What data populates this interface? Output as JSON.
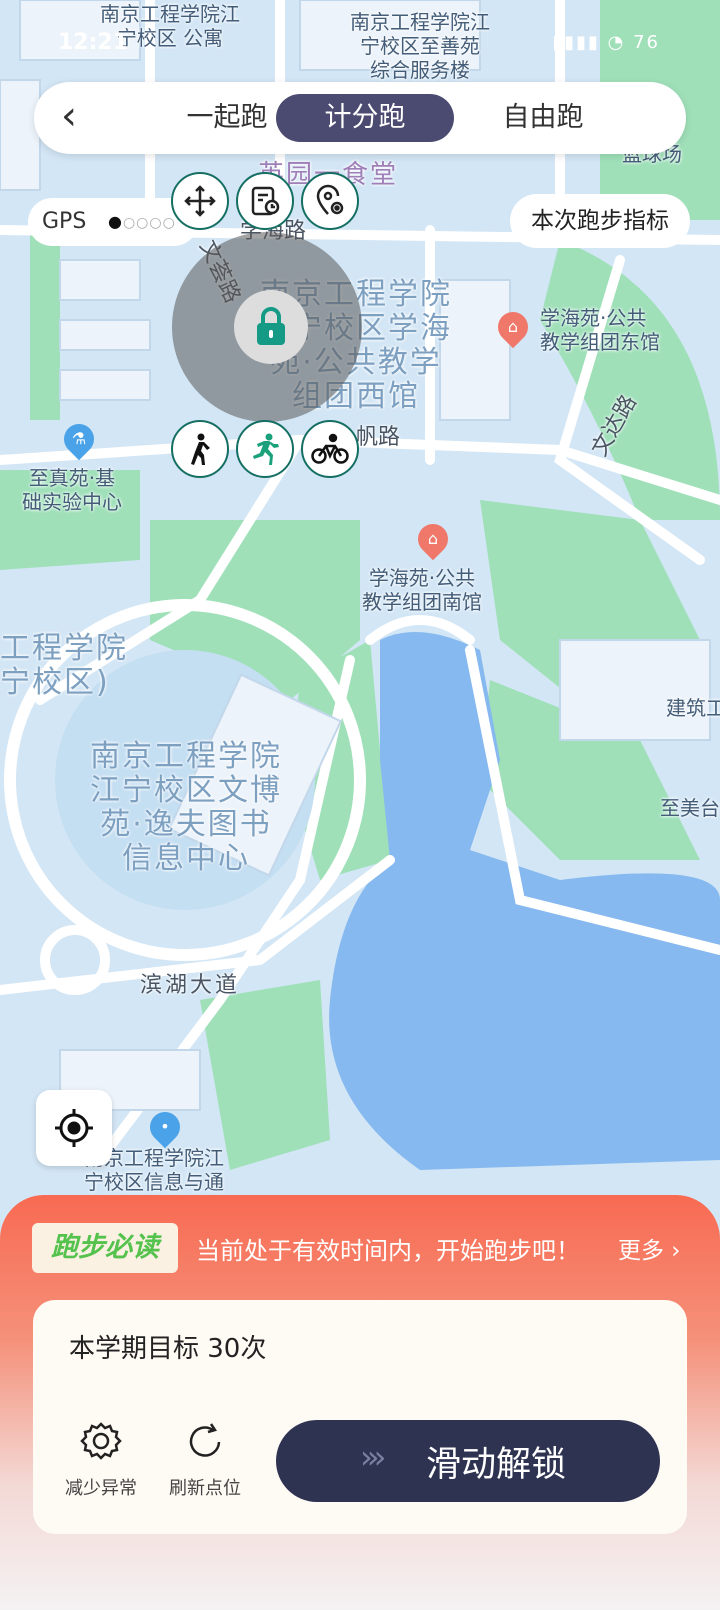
{
  "status_bar": {
    "time": "12:21",
    "icons": "▮▮▮▮ ◔ 76"
  },
  "tabs": {
    "back_icon": "chevron-left-icon",
    "items": [
      {
        "label": "一起跑",
        "active": false
      },
      {
        "label": "计分跑",
        "active": true
      },
      {
        "label": "自由跑",
        "active": false
      }
    ]
  },
  "gps": {
    "label": "GPS"
  },
  "metrics_button": "本次跑步指标",
  "map_labels": {
    "top_left": "南京工程学院江\n宁校区 公寓",
    "top_center": "南京工程学院江\n宁校区至善苑\n综合服务楼",
    "canteen": "英园一食堂",
    "court": "篮球场",
    "road_xuehai": "学海路",
    "road_wenxue": "文荟路",
    "west_building": "南京工程学院\n江宁校区学海\n苑·公共教学\n组团西馆",
    "east_building": "学海苑·公共\n教学组团东馆",
    "road_wenda": "文达路",
    "road_fan": "帆路",
    "lab_center": "至真苑·基\n础实验中心",
    "south_building": "学海苑·公共\n教学组团南馆",
    "campus_left": "工程学院\n宁校区)",
    "library": "南京工程学院\n江宁校区文博\n苑·逸夫图书\n信息中心",
    "architecture": "建筑工",
    "zhimei": "至美台",
    "binhu": "滨湖大道",
    "info_college": "南京工程学院江\n宁校区信息与通"
  },
  "panel": {
    "tag": "跑步必读",
    "notice": "当前处于有效时间内，开始跑步吧！",
    "more": "更多",
    "goal": "本学期目标 30次",
    "reduce_label": "减少异常",
    "refresh_label": "刷新点位",
    "slide_label": "滑动解锁",
    "slide_arrows": "›››"
  },
  "colors": {
    "accent": "#4b4a70",
    "tool_border": "#156f63",
    "slide": "#2f3352",
    "panel_top": "#f86a52"
  }
}
